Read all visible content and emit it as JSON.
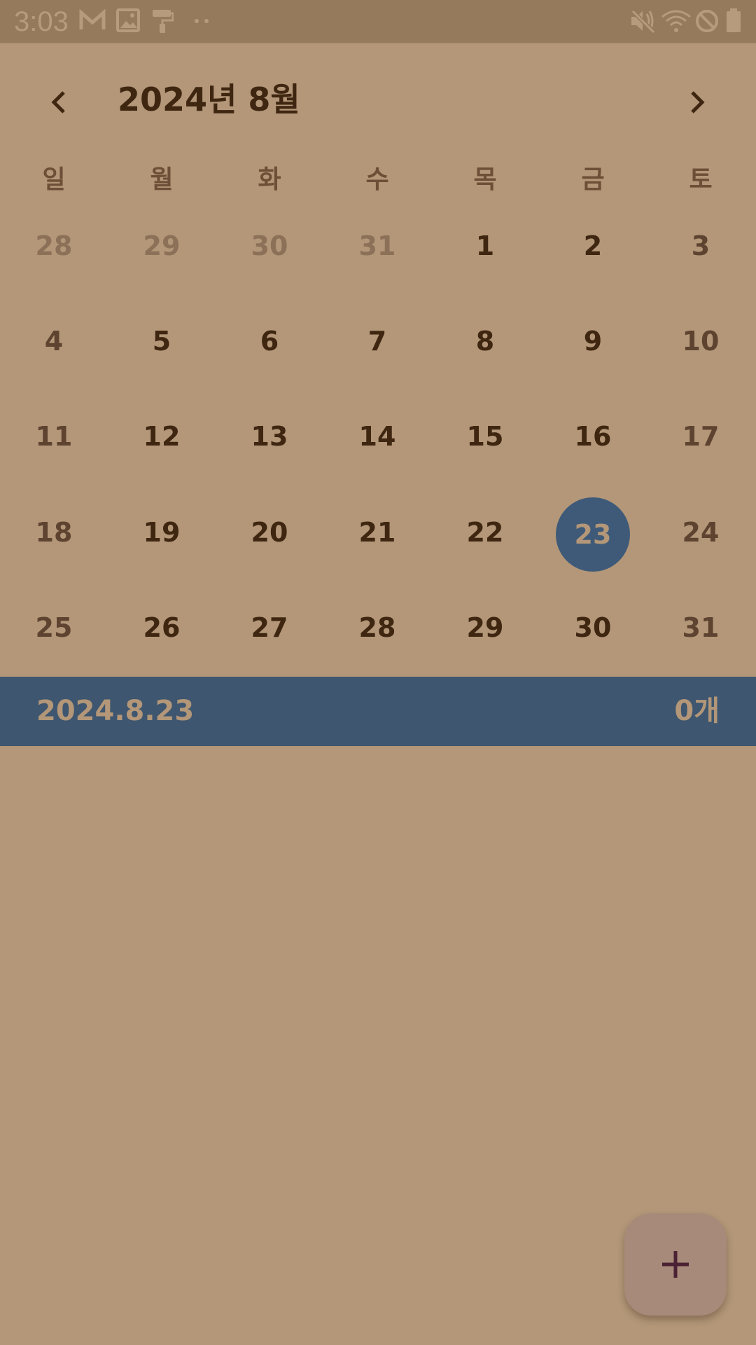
{
  "status_bar": {
    "time": "3:03",
    "left_icons": [
      "gmail-icon",
      "image-icon",
      "paint-roller-icon",
      "more-dots-icon"
    ],
    "right_icons": [
      "mute-icon",
      "wifi-icon",
      "do-not-disturb-icon",
      "battery-icon"
    ]
  },
  "header": {
    "title": "2024년 8월",
    "prev_icon": "chevron-left-icon",
    "next_icon": "chevron-right-icon"
  },
  "calendar": {
    "weekdays": [
      "일",
      "월",
      "화",
      "수",
      "목",
      "금",
      "토"
    ],
    "weeks": [
      [
        "28",
        "29",
        "30",
        "31",
        "1",
        "2",
        "3"
      ],
      [
        "4",
        "5",
        "6",
        "7",
        "8",
        "9",
        "10"
      ],
      [
        "11",
        "12",
        "13",
        "14",
        "15",
        "16",
        "17"
      ],
      [
        "18",
        "19",
        "20",
        "21",
        "22",
        "23",
        "24"
      ],
      [
        "25",
        "26",
        "27",
        "28",
        "29",
        "30",
        "31"
      ]
    ],
    "other_month_days": [
      "28",
      "29",
      "30",
      "31"
    ],
    "selected_day": "23"
  },
  "selected_bar": {
    "date": "2024.8.23",
    "count": "0개"
  },
  "fab": {
    "icon": "plus-icon"
  },
  "colors": {
    "background": "#b39778",
    "accent": "#3e5670",
    "text": "#3f2611",
    "fab": "#a88a7a"
  }
}
